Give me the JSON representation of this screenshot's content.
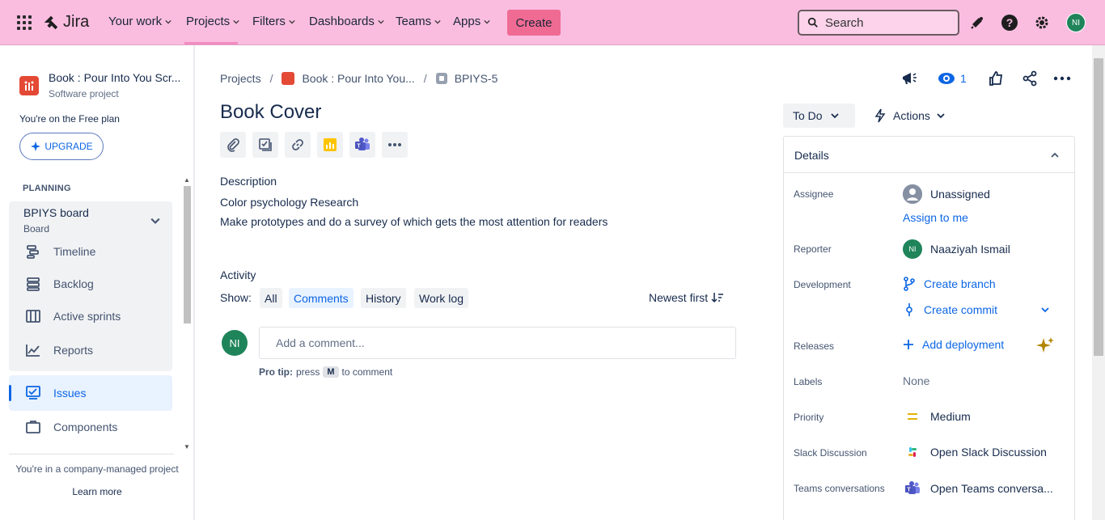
{
  "topnav": {
    "logo_text": "Jira",
    "items": [
      {
        "label": "Your work"
      },
      {
        "label": "Projects"
      },
      {
        "label": "Filters"
      },
      {
        "label": "Dashboards"
      },
      {
        "label": "Teams"
      },
      {
        "label": "Apps"
      }
    ],
    "create_label": "Create",
    "search_placeholder": "Search",
    "user_initials": "NI",
    "colors": {
      "bar": "#FABDE0",
      "create": "#F06B93"
    }
  },
  "sidebar": {
    "project_name": "Book : Pour Into You Scr...",
    "project_type": "Software project",
    "free_plan": "You're on the Free plan",
    "upgrade_label": "UPGRADE",
    "section_planning": "PLANNING",
    "board_title": "BPIYS board",
    "board_subtitle": "Board",
    "items": [
      {
        "label": "Timeline",
        "icon": "timeline-icon"
      },
      {
        "label": "Backlog",
        "icon": "backlog-icon"
      },
      {
        "label": "Active sprints",
        "icon": "sprints-icon"
      },
      {
        "label": "Reports",
        "icon": "reports-icon"
      },
      {
        "label": "Issues",
        "icon": "issues-icon"
      },
      {
        "label": "Components",
        "icon": "components-icon"
      }
    ],
    "company_managed": "You're in a company-managed project",
    "learn_more": "Learn more"
  },
  "issue": {
    "breadcrumb": {
      "projects": "Projects",
      "project": "Book : Pour Into You...",
      "key": "BPIYS-5"
    },
    "title": "Book Cover",
    "description_label": "Description",
    "description_lines": [
      "Color psychology Research",
      "Make prototypes and do a survey of which gets the most attention for readers"
    ],
    "activity_label": "Activity",
    "show_label": "Show:",
    "filters": [
      "All",
      "Comments",
      "History",
      "Work log"
    ],
    "sort_label": "Newest first",
    "comment_avatar": "NI",
    "comment_placeholder": "Add a comment...",
    "pro_tip_bold": "Pro tip:",
    "pro_tip_press": "press",
    "pro_tip_key": "M",
    "pro_tip_rest": "to comment"
  },
  "header_actions": {
    "watch_count": "1",
    "status": "To Do",
    "actions_label": "Actions"
  },
  "details": {
    "title": "Details",
    "assignee_label": "Assignee",
    "assignee_value": "Unassigned",
    "assign_to_me": "Assign to me",
    "reporter_label": "Reporter",
    "reporter_initials": "NI",
    "reporter_value": "Naaziyah Ismail",
    "development_label": "Development",
    "create_branch": "Create branch",
    "create_commit": "Create commit",
    "releases_label": "Releases",
    "add_deployment": "Add deployment",
    "labels_label": "Labels",
    "labels_value": "None",
    "priority_label": "Priority",
    "priority_value": "Medium",
    "slack_label": "Slack Discussion",
    "slack_open": "Open",
    "slack_value": "Slack Discussion",
    "teams_label": "Teams conversations",
    "teams_open": "Open",
    "teams_value": "Teams conversa..."
  }
}
